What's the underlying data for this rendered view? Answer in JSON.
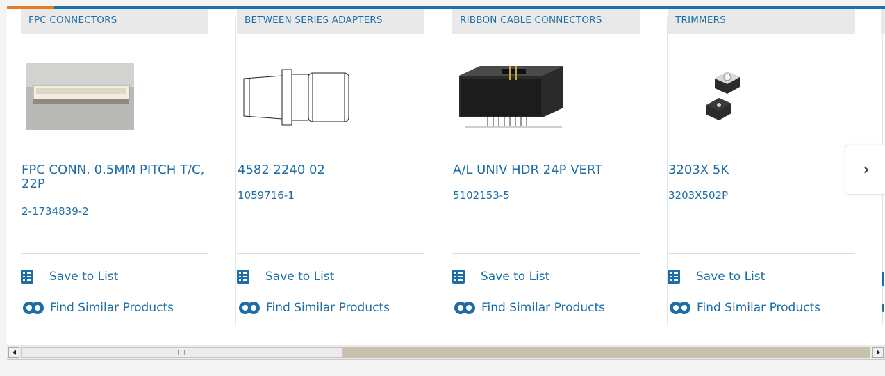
{
  "products": [
    {
      "category": "FPC CONNECTORS",
      "name": "FPC CONN. 0.5MM PITCH T/C, 22P",
      "part_number": "2-1734839-2",
      "save_label": "Save to List",
      "similar_label": "Find Similar Products"
    },
    {
      "category": "BETWEEN SERIES ADAPTERS",
      "name": "4582 2240 02",
      "part_number": "1059716-1",
      "save_label": "Save to List",
      "similar_label": "Find Similar Products"
    },
    {
      "category": "RIBBON CABLE CONNECTORS",
      "name": "A/L UNIV HDR 24P VERT",
      "part_number": "5102153-5",
      "save_label": "Save to List",
      "similar_label": "Find Similar Products"
    },
    {
      "category": "TRIMMERS",
      "name": "3203X 5K",
      "part_number": "3203X502P",
      "save_label": "Save to List",
      "similar_label": "Find Similar Products"
    }
  ],
  "carousel": {
    "next_icon": "chevron-right-icon"
  },
  "scrollbar": {
    "position": 0.38
  },
  "colors": {
    "accent": "#1d6ea6",
    "top_accent": "#e57d22",
    "top_bar": "#1c6fa8"
  }
}
